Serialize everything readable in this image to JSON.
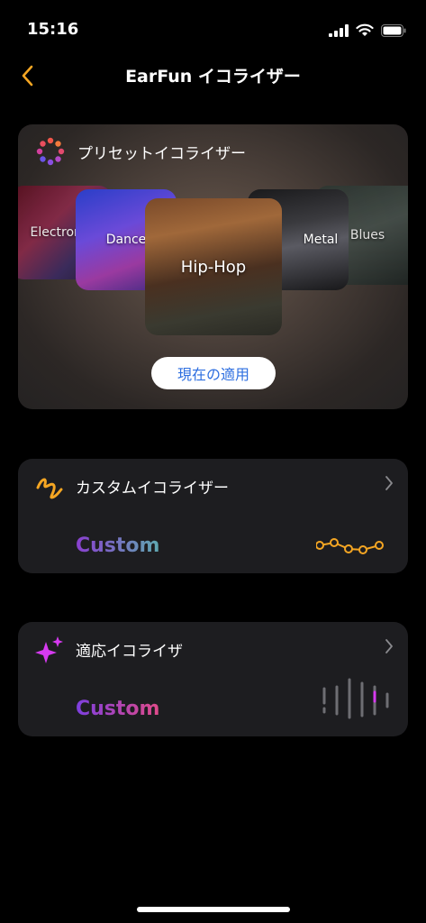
{
  "status_bar": {
    "time": "15:16"
  },
  "nav": {
    "title": "EarFun イコライザー"
  },
  "preset": {
    "title": "プリセットイコライザー",
    "items": [
      {
        "label": "Electronic"
      },
      {
        "label": "Dance"
      },
      {
        "label": "Hip-Hop"
      },
      {
        "label": "Metal"
      },
      {
        "label": "Blues"
      }
    ],
    "apply_label": "現在の適用"
  },
  "custom_eq": {
    "title": "カスタムイコライザー",
    "value": "Custom"
  },
  "adaptive_eq": {
    "title": "適応イコライザ",
    "value": "Custom"
  },
  "colors": {
    "accent": "#f5a623",
    "link": "#2e6fe0",
    "magenta": "#d63af0"
  }
}
